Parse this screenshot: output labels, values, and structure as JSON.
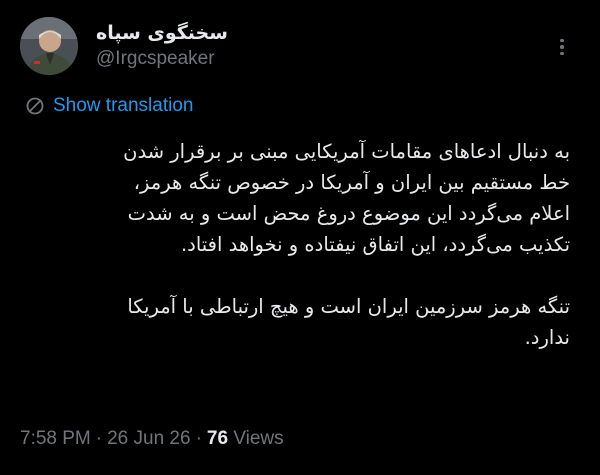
{
  "author": {
    "display_name": "سخنگوی سپاه",
    "handle": "@Irgcspeaker",
    "avatar_icon": "profile-photo"
  },
  "more_icon": "ellipsis-vertical-icon",
  "translate": {
    "icon": "translate-globe-icon",
    "label": "Show translation"
  },
  "tweet": {
    "paragraph1_lines": [
      "به دنبال ادعاهای مقامات آمریکایی مبنی بر برقرار شدن",
      "خط مستقیم بین ایران و آمریکا در خصوص تنگه هرمز،",
      "اعلام می‌گردد این موضوع دروغ محض است و به شدت",
      "تکذیب می‌گردد، این اتفاق نیفتاده و نخواهد افتاد."
    ],
    "paragraph2_lines": [
      "تنگه هرمز سرزمین ایران است و هیچ ارتباطی با آمریکا",
      "ندارد."
    ]
  },
  "meta": {
    "time": "7:58 PM",
    "separator": "·",
    "date": "26 Jun 26",
    "views_count": "76",
    "views_label": "Views"
  },
  "colors": {
    "background": "#000000",
    "text": "#e7e9ea",
    "secondary": "#71767b",
    "link": "#1d9bf0"
  }
}
